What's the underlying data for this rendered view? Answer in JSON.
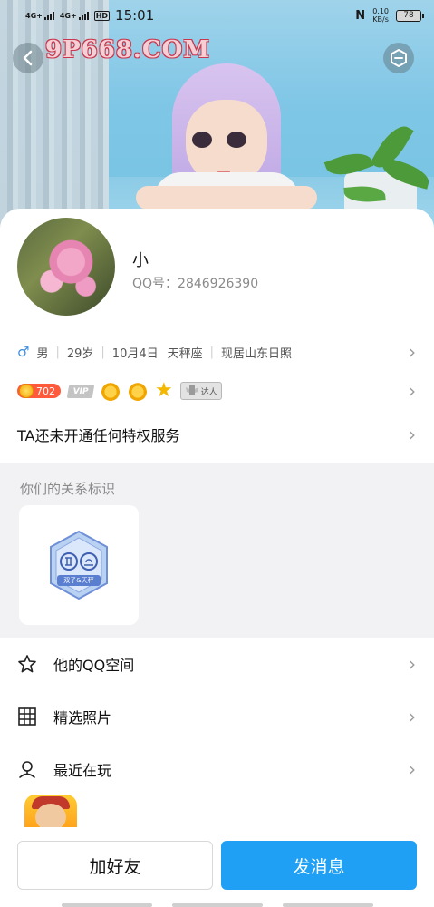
{
  "status_bar": {
    "signal1": "4G+",
    "signal2": "4G+",
    "hd": "HD",
    "time": "15:01",
    "nfc": "N",
    "net_speed_value": "0.10",
    "net_speed_unit": "KB/s",
    "battery": "78"
  },
  "banner": {
    "watermark": "9P668.COM"
  },
  "profile": {
    "nickname": "小",
    "qq_label": "QQ号：2846926390"
  },
  "info": {
    "gender": "男",
    "age": "29岁",
    "birthday": "10月4日",
    "constellation": "天秤座",
    "location": "现居山东日照"
  },
  "badges": {
    "level": "702",
    "vip": "VIP",
    "daren": "达人"
  },
  "privilege_text": "TA还未开通任何特权服务",
  "relationship": {
    "title": "你们的关系标识",
    "badge_label": "双子&天秤"
  },
  "menu": [
    {
      "label": "他的QQ空间",
      "icon": "star-outline-icon"
    },
    {
      "label": "精选照片",
      "icon": "grid-icon"
    },
    {
      "label": "最近在玩",
      "icon": "game-pin-icon"
    }
  ],
  "buttons": {
    "add_friend": "加好友",
    "send_message": "发消息"
  },
  "colors": {
    "accent_blue": "#1fa0f5",
    "section_bg": "#f2f2f4",
    "level_badge": "#ff5a3c"
  }
}
